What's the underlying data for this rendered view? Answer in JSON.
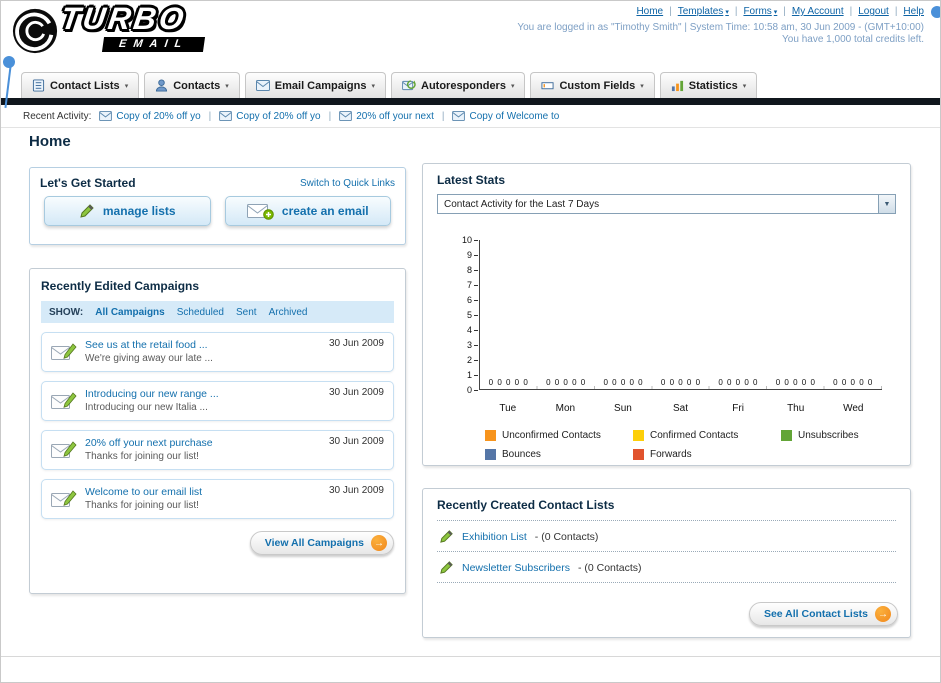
{
  "ui": {
    "separator": "|",
    "caret": "▾",
    "select_arrow": "▼",
    "button_arrow": "→"
  },
  "header": {
    "logo": {
      "title": "TURBO",
      "subtitle": "EMAIL"
    },
    "top_links": {
      "home": "Home",
      "templates": "Templates",
      "forms": "Forms",
      "my_account": "My Account",
      "logout": "Logout",
      "help": "Help"
    },
    "login_info": "You are logged in as \"Timothy Smith\" | System Time: 10:58 am, 30 Jun 2009 - (GMT+10:00)",
    "credits_info": "You have 1,000 total credits left."
  },
  "nav": {
    "tabs": [
      {
        "label": "Contact Lists"
      },
      {
        "label": "Contacts"
      },
      {
        "label": "Email Campaigns"
      },
      {
        "label": "Autoresponders"
      },
      {
        "label": "Custom Fields"
      },
      {
        "label": "Statistics"
      }
    ]
  },
  "recent_activity": {
    "label": "Recent Activity:",
    "items": [
      {
        "text": "Copy of 20% off yo"
      },
      {
        "text": "Copy of 20% off yo"
      },
      {
        "text": "20% off your next"
      },
      {
        "text": "Copy of Welcome to"
      }
    ]
  },
  "page": {
    "title": "Home"
  },
  "get_started": {
    "title": "Let's Get Started",
    "switch_link": "Switch to Quick Links",
    "manage_lists_button": "manage lists",
    "create_email_button": "create an email"
  },
  "campaigns": {
    "title": "Recently Edited Campaigns",
    "show_label": "SHOW:",
    "filters": [
      {
        "label": "All Campaigns"
      },
      {
        "label": "Scheduled"
      },
      {
        "label": "Sent"
      },
      {
        "label": "Archived"
      }
    ],
    "items": [
      {
        "title": "See us at the retail food ...",
        "subtitle": "We're giving away our late ...",
        "date": "30 Jun 2009"
      },
      {
        "title": "Introducing our new range ...",
        "subtitle": "Introducing our new Italia ...",
        "date": "30 Jun 2009"
      },
      {
        "title": "20% off your next purchase",
        "subtitle": "Thanks for joining our list!",
        "date": "30 Jun 2009"
      },
      {
        "title": "Welcome to our email list",
        "subtitle": "Thanks for joining our list!",
        "date": "30 Jun 2009"
      }
    ],
    "view_all_button": "View All Campaigns"
  },
  "stats": {
    "title": "Latest Stats",
    "dropdown_value": "Contact Activity for the Last 7 Days"
  },
  "chart_data": {
    "type": "bar",
    "title": "Contact Activity for the Last 7 Days",
    "categories": [
      "Tue",
      "Mon",
      "Sun",
      "Sat",
      "Fri",
      "Thu",
      "Wed"
    ],
    "series": [
      {
        "name": "Unconfirmed Contacts",
        "color": "#f7941d",
        "values": [
          0,
          0,
          0,
          0,
          0,
          0,
          0
        ]
      },
      {
        "name": "Confirmed Contacts",
        "color": "#fdcf09",
        "values": [
          0,
          0,
          0,
          0,
          0,
          0,
          0
        ]
      },
      {
        "name": "Unsubscribes",
        "color": "#63a537",
        "values": [
          0,
          0,
          0,
          0,
          0,
          0,
          0
        ]
      },
      {
        "name": "Bounces",
        "color": "#5576a7",
        "values": [
          0,
          0,
          0,
          0,
          0,
          0,
          0
        ]
      },
      {
        "name": "Forwards",
        "color": "#e1532d",
        "values": [
          0,
          0,
          0,
          0,
          0,
          0,
          0
        ]
      }
    ],
    "ylim": [
      0,
      10
    ],
    "yticks_desc": [
      10,
      9,
      8,
      7,
      6,
      5,
      4,
      3,
      2,
      1,
      0
    ],
    "value_labels_per_category": [
      "0 0 0 0 0",
      "0 0 0 0 0",
      "0 0 0 0 0",
      "0 0 0 0 0",
      "0 0 0 0 0",
      "0 0 0 0 0",
      "0 0 0 0 0"
    ],
    "grid": false,
    "legend_position": "bottom"
  },
  "contact_lists": {
    "title": "Recently Created Contact Lists",
    "items": [
      {
        "name": "Exhibition List",
        "detail": "- (0 Contacts)"
      },
      {
        "name": "Newsletter Subscribers",
        "detail": "- (0 Contacts)"
      }
    ],
    "see_all_button": "See All Contact Lists"
  }
}
